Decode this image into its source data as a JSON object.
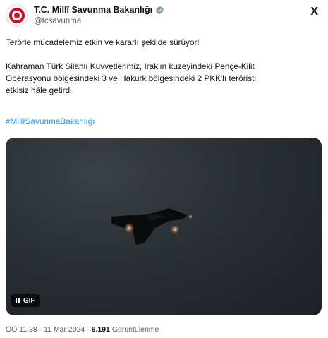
{
  "post": {
    "author_name": "T.C. Millî Savunma Bakanlığı",
    "author_handle": "@tcsavunma",
    "line1": "Terörle mücadelemiz etkin ve kararlı şekilde sürüyor!",
    "body_lines": [
      "Kahraman Türk Silahlı Kuvvetlerimiz, Irak'ın kuzeyindeki Pençe-Kilit",
      "Operasyonu bölgesindeki 3 ve Hakurk bölgesindeki  2 PKK'lı teröristi",
      "etkisiz hâle getirdi."
    ],
    "hashtag": "#MillîSavunmaBakanlığı",
    "gif_label": "GIF",
    "time": "ÖÖ 11:38",
    "date": "11 Mar 2024",
    "views_count": "6.191",
    "views_label": "Görüntülenme",
    "separator": "·"
  },
  "icons": {
    "x_logo": "X",
    "verified_color": "#829aab",
    "hashtag_color": "#1d9bf0"
  }
}
